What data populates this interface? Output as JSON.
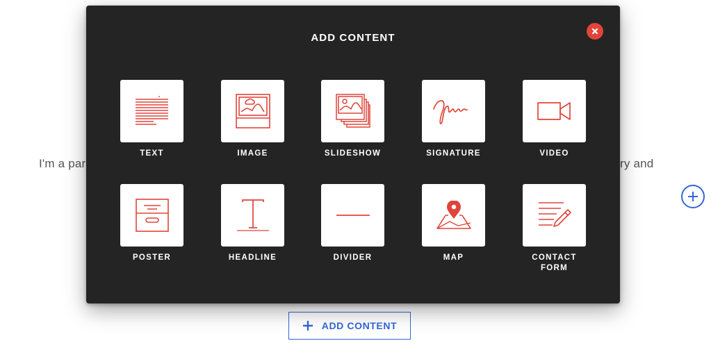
{
  "background": {
    "paragraph_left": "I'm a par",
    "paragraph_right": "ry and",
    "add_content_label": "ADD CONTENT"
  },
  "modal": {
    "title": "ADD CONTENT",
    "items": [
      {
        "label": "TEXT",
        "icon": "text-icon"
      },
      {
        "label": "IMAGE",
        "icon": "image-icon"
      },
      {
        "label": "SLIDESHOW",
        "icon": "slideshow-icon"
      },
      {
        "label": "SIGNATURE",
        "icon": "signature-icon"
      },
      {
        "label": "VIDEO",
        "icon": "video-icon"
      },
      {
        "label": "POSTER",
        "icon": "poster-icon"
      },
      {
        "label": "HEADLINE",
        "icon": "headline-icon"
      },
      {
        "label": "DIVIDER",
        "icon": "divider-icon"
      },
      {
        "label": "MAP",
        "icon": "map-icon"
      },
      {
        "label": "CONTACT\nFORM",
        "icon": "contact-form-icon"
      }
    ]
  },
  "colors": {
    "accent_red": "#e0443a",
    "modal_bg": "#242424",
    "link_blue": "#3367d6"
  }
}
